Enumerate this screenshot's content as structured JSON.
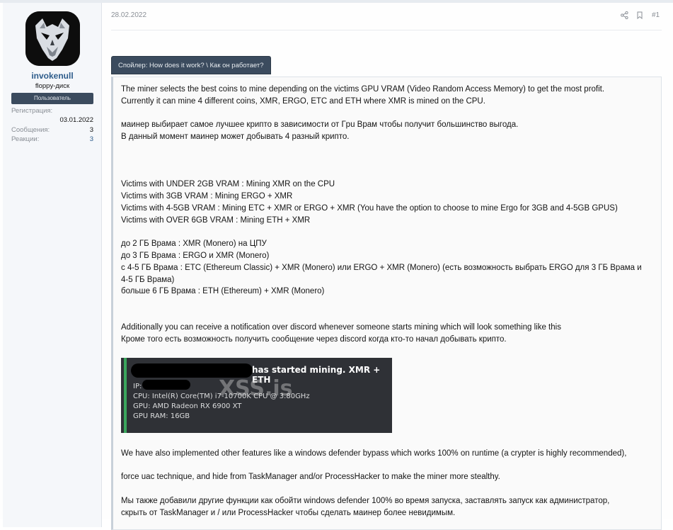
{
  "user": {
    "username": "invokenull",
    "title": "floppy-диск",
    "banner": "Пользователь",
    "stats": [
      {
        "label": "Регистрация:",
        "value": "03.01.2022"
      },
      {
        "label": "Сообщения:",
        "value": "3"
      },
      {
        "label": "Реакции:",
        "value": "3"
      }
    ]
  },
  "message": {
    "date": "28.02.2022",
    "post_number": "#1",
    "icons": [
      "share-icon",
      "bookmark-icon"
    ],
    "spoiler_label": "Спойлер: How does it work? \\ Как он работает?",
    "paragraphs": {
      "p1": "The miner selects the best coins to mine depending on the victims GPU VRAM (Video Random Access Memory) to get the most profit.",
      "p2": "Currently it can mine 4 different coins, XMR, ERGO, ETC and ETH where XMR is mined on the CPU.",
      "p3": "маинер выбирает самое лучшее крипто в зависимости от Гpu Врам чтобы получит большинство выгода.",
      "p4": "В данный момент маинер может добывать 4 разный крипто.",
      "p5": "Victims with UNDER 2GB VRAM : Mining XMR on the CPU",
      "p6": "Victims with 3GB VRAM : Mining ERGO + XMR",
      "p7": "Victims with 4-5GB VRAM : Mining ETC + XMR or ERGO + XMR (You have the option to choose to mine Ergo for 3GB and 4-5GB GPUS)",
      "p8": "Victims with OVER 6GB VRAM : Mining ETH + XMR",
      "p9": "до 2 ГБ Врама : XMR (Monero) на ЦПУ",
      "p10": "до 3 ГБ Врама : ERGO и XMR (Monero)",
      "p11": "с 4-5 ГБ Врама : ETC (Ethereum Classic) + XMR (Monero) или ERGO + XMR (Monero) (есть возможность выбрать ERGO для 3 ГБ Врама и 4-5 ГБ Врама)",
      "p12": "больше 6 ГБ Врама : ETH (Ethereum) + XMR (Monero)",
      "p13": "Additionally you can receive a notification over discord whenever someone starts mining which will look something like this",
      "p14": "Кроме того есть возможность получить сообщение через discord когда кто-то начал добывать крипто.",
      "p15": "We have also implemented other features like a windows defender bypass which works 100% on runtime (a crypter is highly recommended),",
      "p16": "force uac technique, and hide from TaskManager and/or ProcessHacker to make the miner more stealthy.",
      "p17": "Мы также добавили другие функции как обойти windows defender 100% во время запуска, заставлять запуск как администратор,",
      "p18": "скрыть от TaskManager и / или ProcessHacker чтобы сделать маинер более невидимым."
    },
    "discord_image": {
      "title": "has started mining. XMR + ETH",
      "ip_label": "IP:",
      "cpu": "CPU: Intel(R) Core(TM) i7-10700K CPU @ 3.80GHz",
      "gpu": "GPU: AMD Radeon RX 6900 XT",
      "ram": "GPU RAM: 16GB",
      "watermark": "XSS.is"
    }
  }
}
